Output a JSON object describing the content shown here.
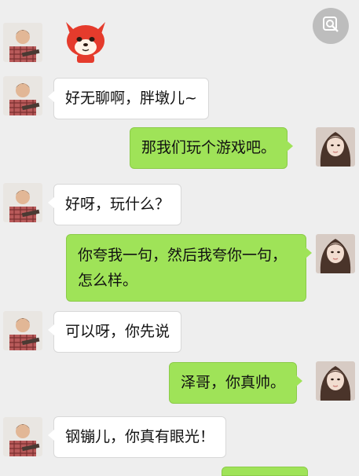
{
  "messages": [
    {
      "side": "left",
      "type": "sticker",
      "sticker": "red-fox-cartoon-sticker"
    },
    {
      "side": "left",
      "type": "text",
      "text": "好无聊啊，胖墩儿~"
    },
    {
      "side": "right",
      "type": "text",
      "text": "那我们玩个游戏吧。"
    },
    {
      "side": "left",
      "type": "text",
      "text": "好呀，玩什么？"
    },
    {
      "side": "right",
      "type": "text",
      "text": "你夸我一句，然后我夸你一句，怎么样。"
    },
    {
      "side": "left",
      "type": "text",
      "text": "可以呀，你先说"
    },
    {
      "side": "right",
      "type": "text",
      "text": "泽哥，你真帅。"
    },
    {
      "side": "left",
      "type": "text",
      "text": "钢镚儿，你真有眼光！"
    }
  ],
  "avatars": {
    "left": "man-plaid-shirt-avatar",
    "right": "woman-long-hair-avatar"
  },
  "search_button": {
    "icon": "magnify-icon"
  },
  "colors": {
    "background": "#eeeeee",
    "incoming_bubble": "#ffffff",
    "outgoing_bubble": "#9fe358"
  }
}
